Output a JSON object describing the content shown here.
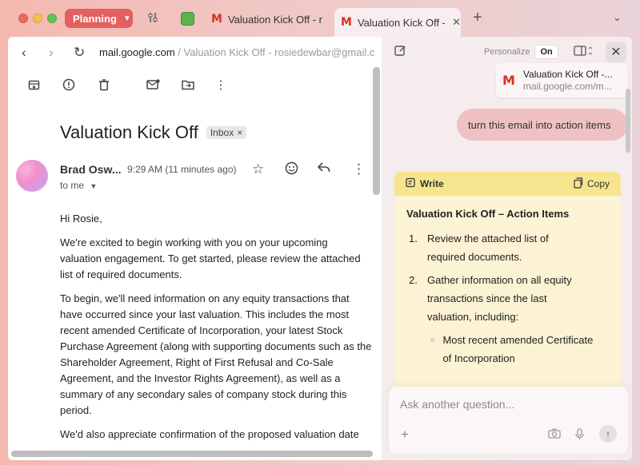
{
  "tabstrip": {
    "space_label": "Planning",
    "tabs": [
      {
        "icon": "gmail-icon",
        "title": "Valuation Kick Off - ros"
      },
      {
        "icon": "gmail-icon",
        "title": "Valuation Kick Off - ros"
      }
    ]
  },
  "address": {
    "host": "mail.google.com",
    "path": " / Valuation Kick Off - rosiedewbar@gmail.c..."
  },
  "email": {
    "subject": "Valuation Kick Off",
    "label": "Inbox",
    "sender": "Brad Osw...",
    "time": "9:29 AM (11 minutes ago)",
    "to": "to me",
    "paragraphs": [
      "Hi Rosie,",
      "We're excited to begin working with you on your upcoming valuation engagement. To get started, please review the attached list of required documents.",
      "To begin, we'll need information on any equity transactions that have occurred since your last valuation. This includes the most recent amended Certificate of Incorporation, your latest Stock Purchase Agreement (along with supporting documents such as the Shareholder Agreement, Right of First Refusal and Co-Sale Agreement, and the Investor Rights Agreement), as well as a summary of any secondary sales of company stock during this period.",
      "We'd also appreciate confirmation of the proposed valuation date"
    ]
  },
  "assistant": {
    "personalize_label": "Personalize",
    "personalize_state": "On",
    "attachment": {
      "title": "Valuation Kick Off -...",
      "subtitle": "mail.google.com/m..."
    },
    "user_message": "turn this email into action items",
    "card": {
      "write_label": "Write",
      "copy_label": "Copy",
      "title": "Valuation Kick Off – Action Items",
      "items": [
        {
          "n": "1.",
          "text": "Review the attached list of required documents."
        },
        {
          "n": "2.",
          "text": "Gather information on all equity transactions since the last valuation, including:"
        }
      ],
      "subitems": [
        "Most recent amended Certificate of Incorporation"
      ]
    },
    "input_placeholder": "Ask another question..."
  }
}
